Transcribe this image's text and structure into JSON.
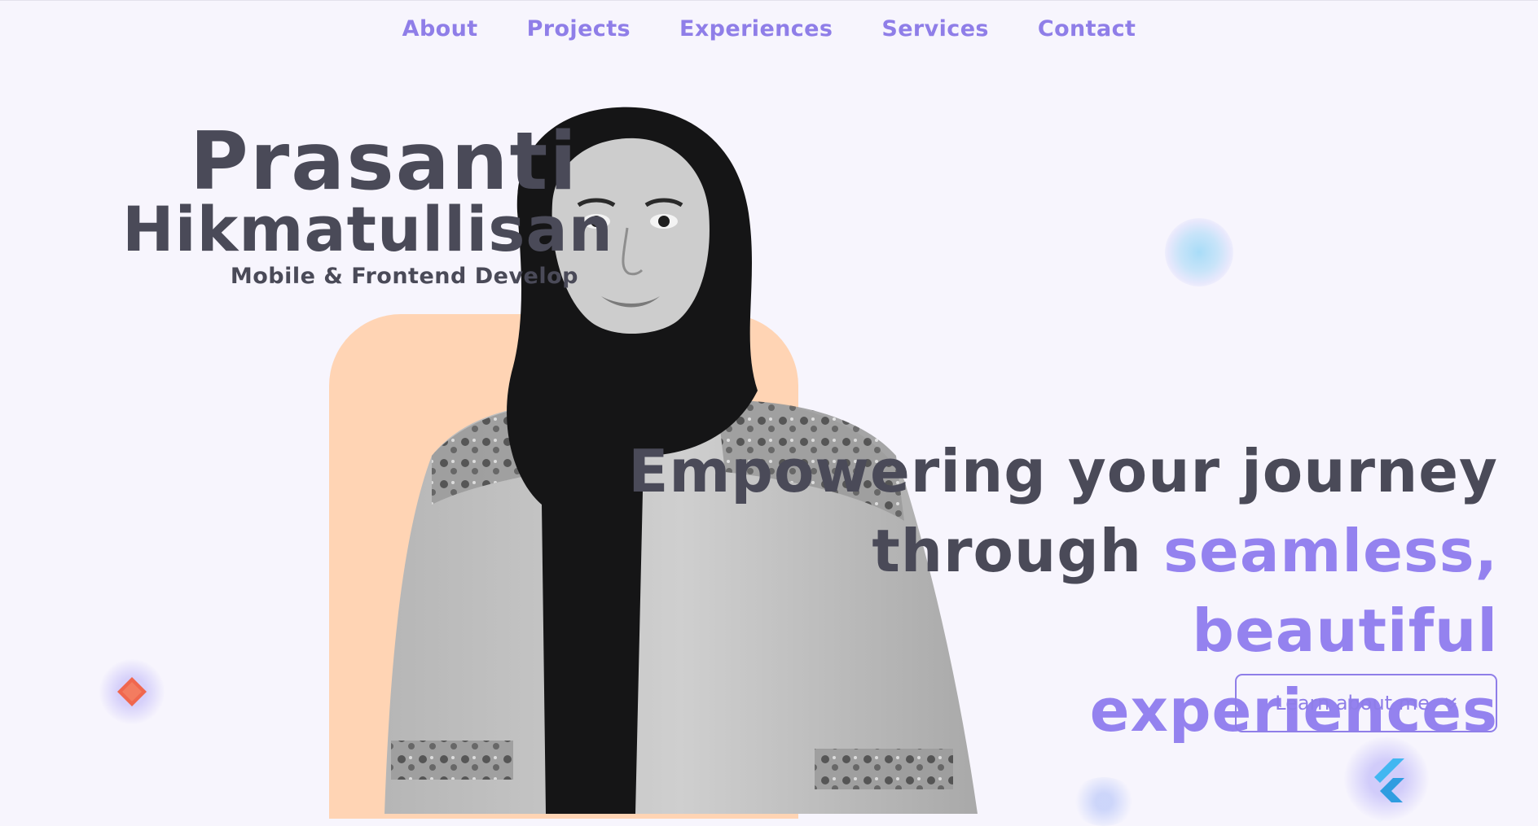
{
  "nav": {
    "items": [
      {
        "label": "About"
      },
      {
        "label": "Projects"
      },
      {
        "label": "Experiences"
      },
      {
        "label": "Services"
      },
      {
        "label": "Contact"
      }
    ]
  },
  "hero": {
    "first_name": "Prasanti",
    "last_name": "Hikmatullisan",
    "role": "Mobile & Frontend Develop",
    "tagline_line1": "Empowering your journey",
    "tagline_through": "through",
    "tagline_accent_1": "seamless, beautiful",
    "tagline_accent_2": "experiences",
    "cta_label": "Learn about me",
    "cta_icon": "chevrons-down-icon"
  },
  "decor": {
    "icons": [
      "dart-icon",
      "flutter-icon"
    ]
  },
  "colors": {
    "accent": "#9482ef",
    "background": "#f7f5fd",
    "peach": "#ffd4b4",
    "text": "#4a4a58"
  }
}
